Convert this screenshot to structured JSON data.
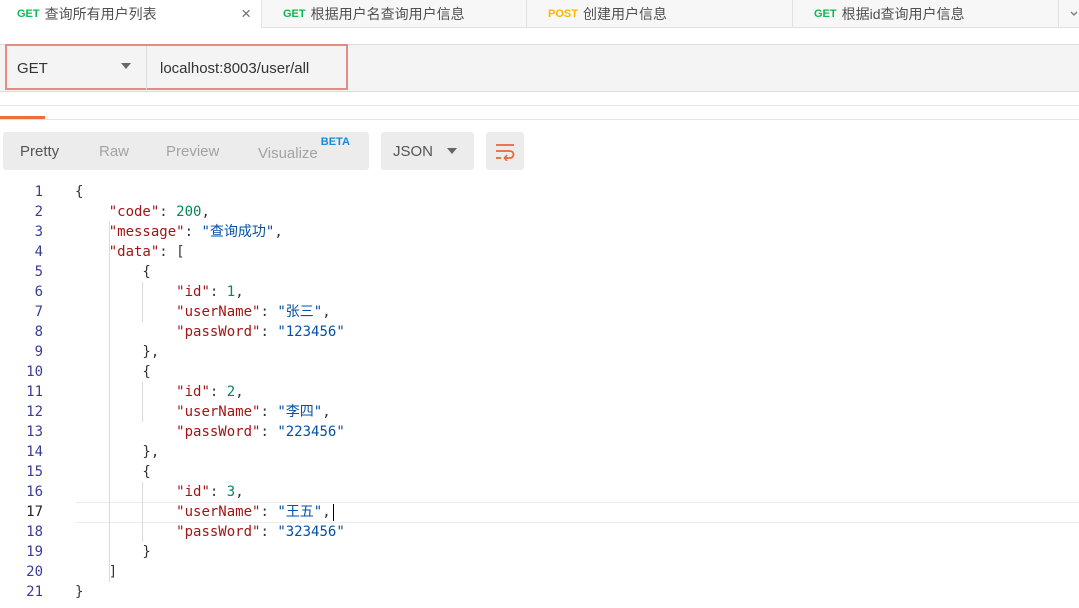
{
  "tabs": [
    {
      "method": "GET",
      "title": "查询所有用户列表",
      "active": true
    },
    {
      "method": "GET",
      "title": "根据用户名查询用户信息",
      "active": false
    },
    {
      "method": "POST",
      "title": "创建用户信息",
      "active": false
    },
    {
      "method": "GET",
      "title": "根据id查询用户信息",
      "active": false
    }
  ],
  "tab_close_icon": "×",
  "tab_overflow_icon": "chevron-down-icon",
  "request": {
    "method": "GET",
    "url": "localhost:8003/user/all"
  },
  "response_views": {
    "items": [
      "Pretty",
      "Raw",
      "Preview",
      "Visualize"
    ],
    "beta_badge": "BETA",
    "active": "Pretty"
  },
  "format": "JSON",
  "wrap_icon": "wrap-lines-icon",
  "colors": {
    "get": "#0cbb52",
    "post": "#ffb400",
    "highlight_border": "#e58a85",
    "accent": "#f26b3a",
    "beta": "#1a8ad6"
  },
  "code_lines": [
    {
      "n": "1",
      "t": "{"
    },
    {
      "n": "2",
      "t": "    \"code\": 200,"
    },
    {
      "n": "3",
      "t": "    \"message\": \"查询成功\","
    },
    {
      "n": "4",
      "t": "    \"data\": ["
    },
    {
      "n": "5",
      "t": "        {"
    },
    {
      "n": "6",
      "t": "            \"id\": 1,"
    },
    {
      "n": "7",
      "t": "            \"userName\": \"张三\","
    },
    {
      "n": "8",
      "t": "            \"passWord\": \"123456\""
    },
    {
      "n": "9",
      "t": "        },"
    },
    {
      "n": "10",
      "t": "        {"
    },
    {
      "n": "11",
      "t": "            \"id\": 2,"
    },
    {
      "n": "12",
      "t": "            \"userName\": \"李四\","
    },
    {
      "n": "13",
      "t": "            \"passWord\": \"223456\""
    },
    {
      "n": "14",
      "t": "        },"
    },
    {
      "n": "15",
      "t": "        {"
    },
    {
      "n": "16",
      "t": "            \"id\": 3,"
    },
    {
      "n": "17",
      "t": "            \"userName\": \"王五\","
    },
    {
      "n": "18",
      "t": "            \"passWord\": \"323456\""
    },
    {
      "n": "19",
      "t": "        }"
    },
    {
      "n": "20",
      "t": "    ]"
    },
    {
      "n": "21",
      "t": "}"
    }
  ],
  "current_line": "17"
}
